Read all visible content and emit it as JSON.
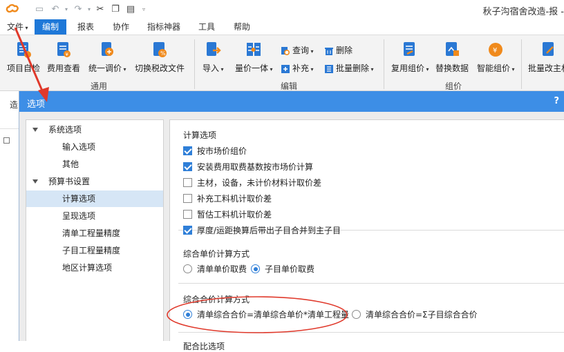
{
  "window": {
    "title": "秋子沟宿舍改造-报 -"
  },
  "menu": {
    "tabs": [
      {
        "label": "文件"
      },
      {
        "label": "编制"
      },
      {
        "label": "报表"
      },
      {
        "label": "协作"
      },
      {
        "label": "指标神器"
      },
      {
        "label": "工具"
      },
      {
        "label": "帮助"
      }
    ],
    "active_tab": "编制"
  },
  "ribbon": {
    "general": {
      "label": "通用",
      "buttons": [
        {
          "label": "项目自检"
        },
        {
          "label": "费用查看"
        },
        {
          "label": "统一调价"
        },
        {
          "label": "切换税改文件"
        }
      ]
    },
    "edit": {
      "label": "编辑",
      "buttons": [
        {
          "label": "导入"
        },
        {
          "label": "量价一体"
        }
      ],
      "small_buttons": [
        {
          "label": "查询"
        },
        {
          "label": "删除"
        },
        {
          "label": "补充"
        },
        {
          "label": "批量删除"
        }
      ]
    },
    "pricing": {
      "label": "组价",
      "buttons": [
        {
          "label": "复用组价"
        },
        {
          "label": "替换数据"
        },
        {
          "label": "智能组价"
        }
      ]
    },
    "extra": {
      "buttons": [
        {
          "label": "批量改主材"
        }
      ]
    }
  },
  "background": {
    "left_label": "造"
  },
  "dialog": {
    "title": "选项",
    "help": "?",
    "tree": [
      {
        "label": "系统选项",
        "level": 0,
        "expanded": true
      },
      {
        "label": "输入选项",
        "level": 1
      },
      {
        "label": "其他",
        "level": 1
      },
      {
        "label": "预算书设置",
        "level": 0,
        "expanded": true
      },
      {
        "label": "计算选项",
        "level": 1,
        "selected": true
      },
      {
        "label": "呈现选项",
        "level": 1
      },
      {
        "label": "清单工程量精度",
        "level": 1
      },
      {
        "label": "子目工程量精度",
        "level": 1
      },
      {
        "label": "地区计算选项",
        "level": 1
      }
    ],
    "calc_options": {
      "title": "计算选项",
      "items": [
        {
          "label": "按市场价组价",
          "checked": true
        },
        {
          "label": "安装费用取费基数按市场价计算",
          "checked": true
        },
        {
          "label": "主材，设备，未计价材料计取价差",
          "checked": false
        },
        {
          "label": "补充工料机计取价差",
          "checked": false
        },
        {
          "label": "暂估工料机计取价差",
          "checked": false
        },
        {
          "label": "厚度/运距换算后带出子目合并到主子目",
          "checked": true
        }
      ]
    },
    "unit_price_method": {
      "title": "综合单价计算方式",
      "options": [
        {
          "label": "清单单价取费",
          "selected": false
        },
        {
          "label": "子目单价取费",
          "selected": true
        }
      ]
    },
    "total_price_method": {
      "title": "综合合价计算方式",
      "options": [
        {
          "label": "清单综合合价=清单综合单价*清单工程量",
          "selected": true
        },
        {
          "label": "清单综合合价=Σ子目综合合价",
          "selected": false
        }
      ]
    },
    "mix_options": {
      "title": "配合比选项"
    }
  },
  "colors": {
    "accent": "#1e78d8",
    "dialog_title_bg": "#3d8ee6",
    "annotation": "#e0392b",
    "checkbox_on": "#2f7fd8"
  }
}
